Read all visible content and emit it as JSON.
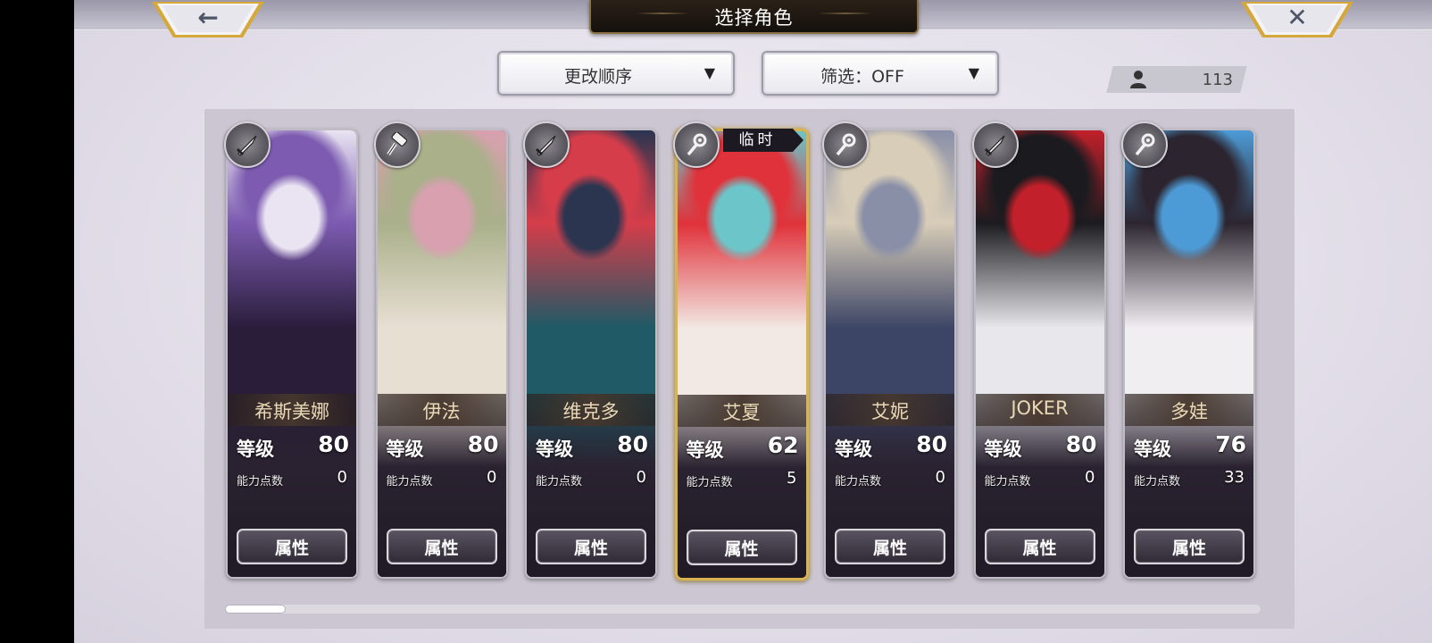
{
  "screen": {
    "title": "选择角色",
    "back_glyph": "←",
    "close_glyph": "✕"
  },
  "controls": {
    "order": {
      "label": "更改顺序",
      "arrow": "▼"
    },
    "filter": {
      "label": "筛选：OFF",
      "arrow": "▼"
    },
    "character_count": "113"
  },
  "tags": {
    "temporary": "临时"
  },
  "stats_labels": {
    "level": "等级",
    "ability_points": "能力点数",
    "attributes_button": "属性"
  },
  "characters": [
    {
      "name": "希斯美娜",
      "level": "80",
      "ability_points": "0",
      "weapon": "sword-icon",
      "selected": false,
      "colors": [
        "#7c5bb0",
        "#2a1d3a",
        "#e9e3f2"
      ]
    },
    {
      "name": "伊法",
      "level": "80",
      "ability_points": "0",
      "weapon": "hammer-icon",
      "selected": false,
      "colors": [
        "#a9b08a",
        "#e8dfd3",
        "#d9a0b0"
      ]
    },
    {
      "name": "维克多",
      "level": "80",
      "ability_points": "0",
      "weapon": "sword-icon",
      "selected": false,
      "colors": [
        "#d63d4a",
        "#1f5a66",
        "#2b3550"
      ]
    },
    {
      "name": "艾夏",
      "level": "62",
      "ability_points": "5",
      "weapon": "staff-icon",
      "selected": true,
      "temporary": true,
      "colors": [
        "#e0323a",
        "#f2e9e4",
        "#6cc5c9"
      ]
    },
    {
      "name": "艾妮",
      "level": "80",
      "ability_points": "0",
      "weapon": "staff-icon",
      "selected": false,
      "colors": [
        "#d8cdb8",
        "#3d4566",
        "#8a8fa8"
      ]
    },
    {
      "name": "JOKER",
      "level": "80",
      "ability_points": "0",
      "weapon": "sword-icon",
      "selected": false,
      "colors": [
        "#1b1b1f",
        "#e8e8ec",
        "#c2202a"
      ]
    },
    {
      "name": "多娃",
      "level": "76",
      "ability_points": "33",
      "weapon": "staff-icon",
      "selected": false,
      "colors": [
        "#2c2530",
        "#f1eef2",
        "#4d9bd6"
      ]
    }
  ]
}
